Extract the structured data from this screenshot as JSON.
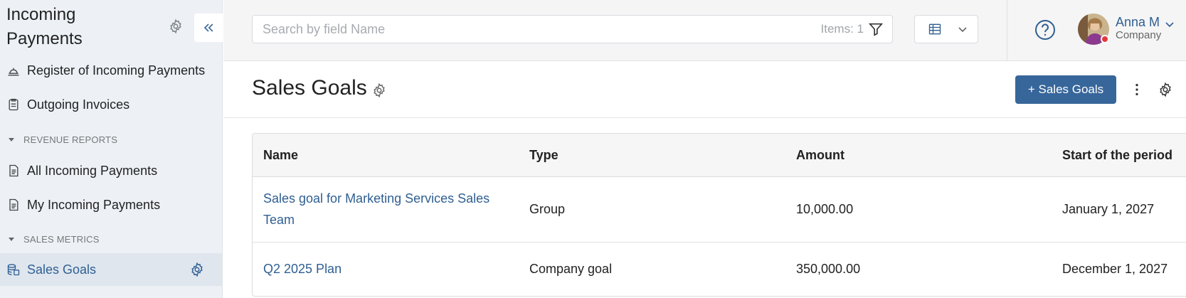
{
  "sidebar": {
    "app_title": "Incoming Payments",
    "items": [
      {
        "label": "Register of Incoming Payments",
        "icon": "bell-tray-icon"
      },
      {
        "label": "Outgoing Invoices",
        "icon": "clipboard-icon"
      },
      {
        "label": "All Incoming Payments",
        "icon": "document-icon"
      },
      {
        "label": "My Incoming Payments",
        "icon": "document-icon"
      },
      {
        "label": "Sales Goals",
        "icon": "coins-icon"
      }
    ],
    "sections": [
      "REVENUE REPORTS",
      "SALES METRICS"
    ],
    "active_item": "Sales Goals"
  },
  "topbar": {
    "search_placeholder": "Search by field Name",
    "items_count": "Items: 1",
    "user": {
      "name": "Anna M",
      "company": "Company"
    }
  },
  "page": {
    "title": "Sales Goals",
    "add_button": "+ Sales Goals"
  },
  "table": {
    "columns": [
      "Name",
      "Type",
      "Amount",
      "Start of the period"
    ],
    "rows": [
      {
        "name": "Sales goal for Marketing Services Sales Team",
        "type": "Group",
        "amount": "10,000.00",
        "start": "January 1, 2027"
      },
      {
        "name": "Q2 2025 Plan",
        "type": "Company goal",
        "amount": "350,000.00",
        "start": "December 1, 2027"
      }
    ]
  },
  "colors": {
    "accent": "#37669a",
    "link": "#2f5f92",
    "sidebar_bg": "#edf1f6",
    "status_dot": "#e03a3a"
  }
}
